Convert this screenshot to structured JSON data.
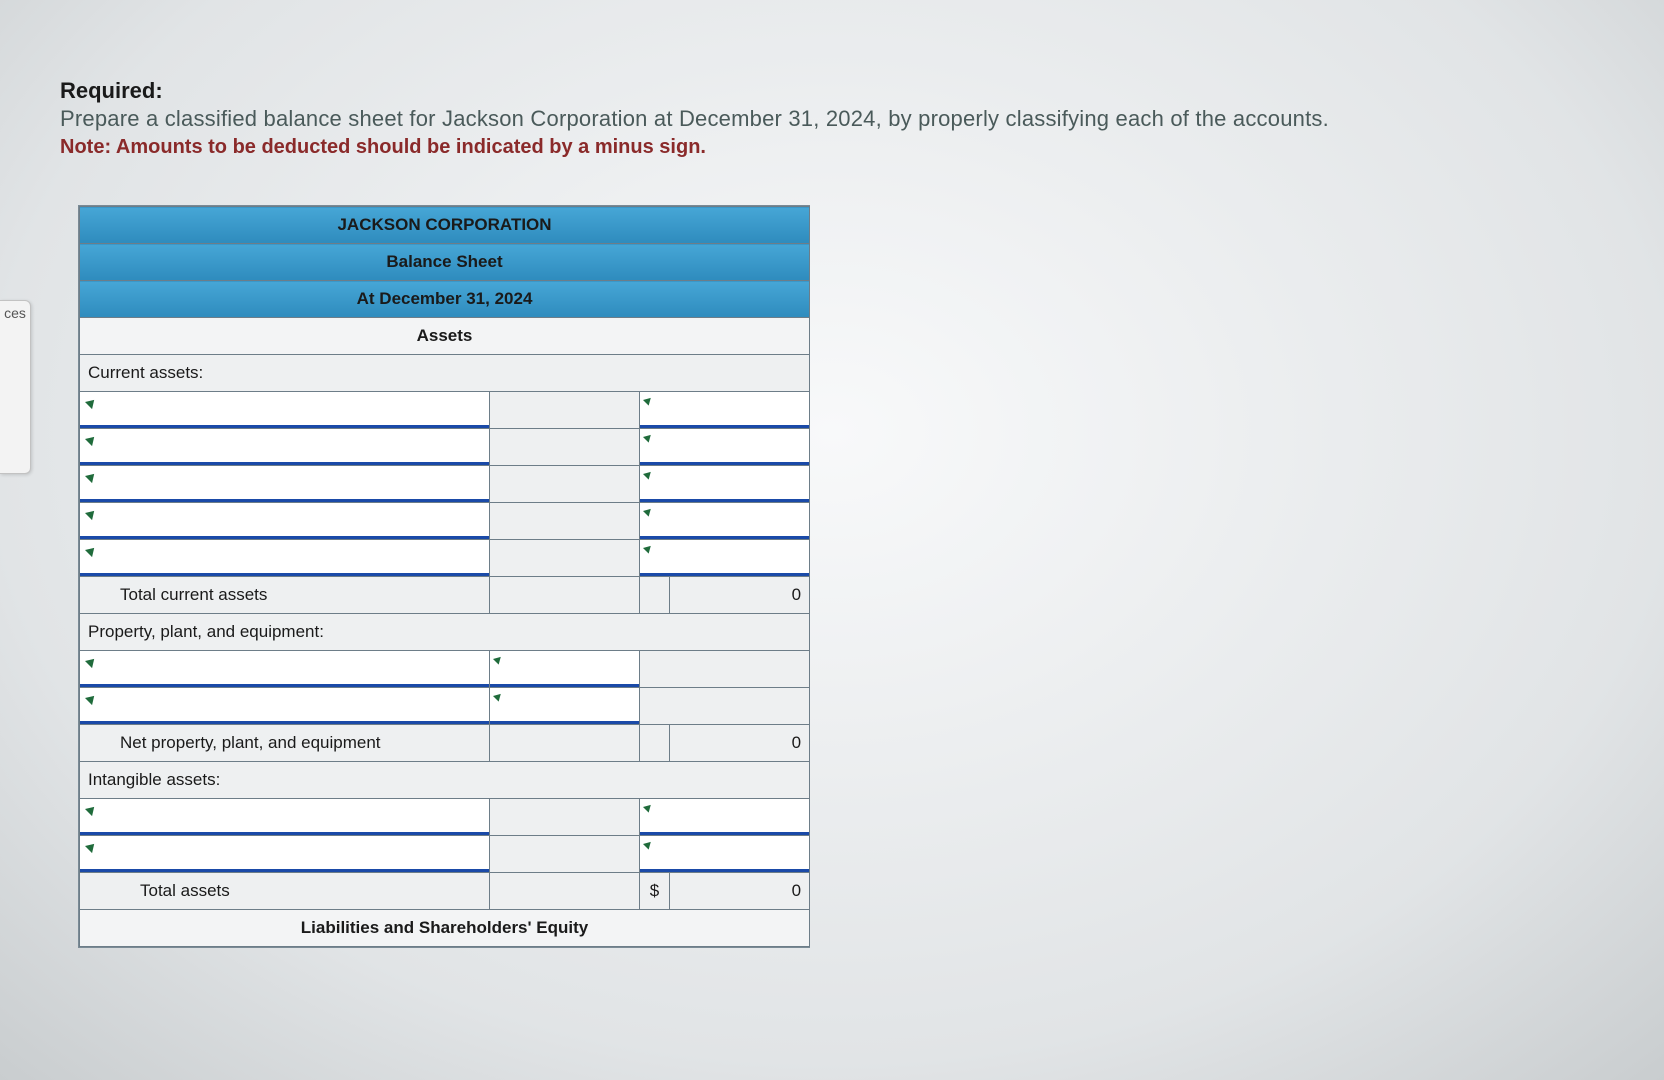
{
  "side_tab_fragment": "ces",
  "required": {
    "label": "Required:",
    "body": "Prepare a classified balance sheet for Jackson Corporation at December 31, 2024, by properly classifying each of the accounts.",
    "note": "Note: Amounts to be deducted should be indicated by a minus sign."
  },
  "sheet": {
    "company": "JACKSON CORPORATION",
    "title": "Balance Sheet",
    "date": "At December 31, 2024",
    "section_assets": "Assets",
    "labels": {
      "current_assets": "Current assets:",
      "total_current_assets": "Total current assets",
      "ppe": "Property, plant, and equipment:",
      "net_ppe": "Net property, plant, and equipment",
      "intangibles": "Intangible assets:",
      "total_assets": "Total assets"
    },
    "section_liab": "Liabilities and Shareholders' Equity",
    "values": {
      "total_current_assets": "0",
      "net_ppe": "0",
      "total_assets": "0",
      "total_assets_symbol": "$"
    }
  }
}
